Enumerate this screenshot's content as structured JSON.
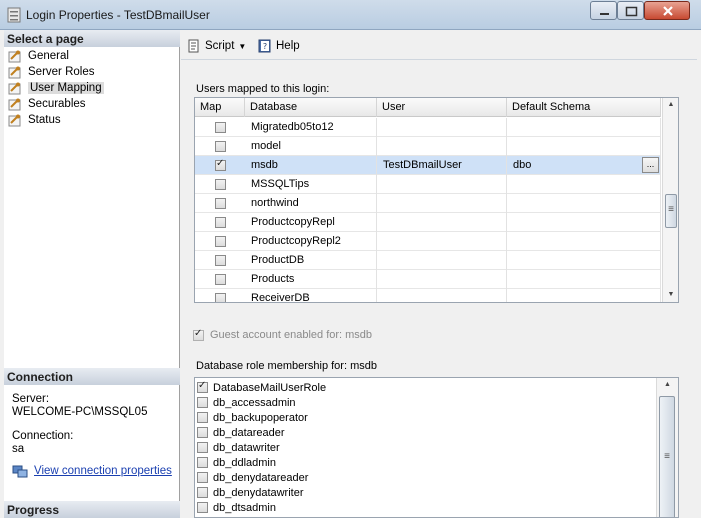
{
  "window": {
    "title": "Login Properties - TestDBmailUser"
  },
  "left_pane": {
    "select_page_header": "Select a page",
    "pages": [
      {
        "label": "General",
        "selected": false
      },
      {
        "label": "Server Roles",
        "selected": false
      },
      {
        "label": "User Mapping",
        "selected": true
      },
      {
        "label": "Securables",
        "selected": false
      },
      {
        "label": "Status",
        "selected": false
      }
    ],
    "connection_header": "Connection",
    "server_label": "Server:",
    "server_value": "WELCOME-PC\\MSSQL05",
    "connection_label": "Connection:",
    "connection_value": "sa",
    "view_connection_link": "View connection properties",
    "progress_header": "Progress"
  },
  "toolbar": {
    "script_label": "Script",
    "help_label": "Help"
  },
  "users_mapped": {
    "label": "Users mapped to this login:",
    "columns": [
      "Map",
      "Database",
      "User",
      "Default Schema"
    ],
    "rows": [
      {
        "map": false,
        "database": "Migratedb05to12",
        "user": "",
        "schema": ""
      },
      {
        "map": false,
        "database": "model",
        "user": "",
        "schema": ""
      },
      {
        "map": true,
        "database": "msdb",
        "user": "TestDBmailUser",
        "schema": "dbo",
        "selected": true
      },
      {
        "map": false,
        "database": "MSSQLTips",
        "user": "",
        "schema": ""
      },
      {
        "map": false,
        "database": "northwind",
        "user": "",
        "schema": ""
      },
      {
        "map": false,
        "database": "ProductcopyRepl",
        "user": "",
        "schema": ""
      },
      {
        "map": false,
        "database": "ProductcopyRepl2",
        "user": "",
        "schema": ""
      },
      {
        "map": false,
        "database": "ProductDB",
        "user": "",
        "schema": ""
      },
      {
        "map": false,
        "database": "Products",
        "user": "",
        "schema": ""
      },
      {
        "map": false,
        "database": "ReceiverDB",
        "user": "",
        "schema": ""
      }
    ],
    "ellipsis_label": "..."
  },
  "guest_account": {
    "label": "Guest account enabled for: msdb",
    "checked": true,
    "disabled": true
  },
  "role_membership": {
    "label": "Database role membership for: msdb",
    "roles": [
      {
        "name": "DatabaseMailUserRole",
        "checked": true
      },
      {
        "name": "db_accessadmin",
        "checked": false
      },
      {
        "name": "db_backupoperator",
        "checked": false
      },
      {
        "name": "db_datareader",
        "checked": false
      },
      {
        "name": "db_datawriter",
        "checked": false
      },
      {
        "name": "db_ddladmin",
        "checked": false
      },
      {
        "name": "db_denydatareader",
        "checked": false
      },
      {
        "name": "db_denydatawriter",
        "checked": false
      },
      {
        "name": "db_dtsadmin",
        "checked": false
      }
    ]
  }
}
